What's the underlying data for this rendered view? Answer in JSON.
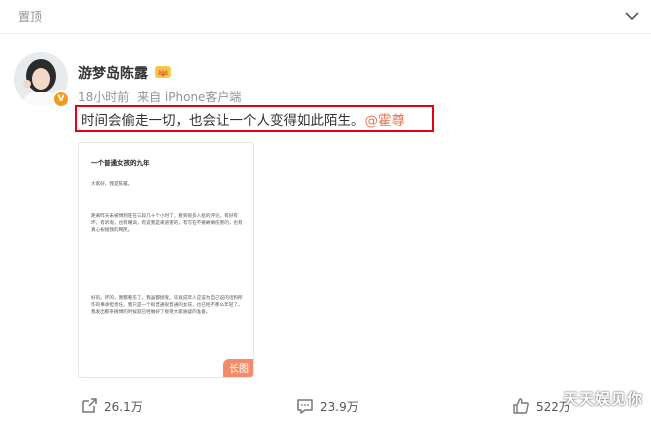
{
  "header": {
    "pin_label": "置顶",
    "chevron_icon": "chevron-down-icon"
  },
  "post": {
    "username": "游梦岛陈露",
    "verified_badge": "V",
    "time": "18小时前",
    "source": "来自 iPhone客户端",
    "text": "时间会偷走一切，也会让一个人变得如此陌生。",
    "mention": "@霍尊",
    "highlight_color": "#e60012"
  },
  "long_image": {
    "title": "一个普通女孩的九年",
    "greeting": "大家好，我是陈露。",
    "para1": "距离昨天未被博到旺在三段几十个小时了，看到很多人给的评论，有好有坏，有听瑕，也有嘲讽，有说我是来道害的，有写在不要故嘛伤害的，也有真心祝福我的网民。",
    "para2": "好的。坏的，我都看见了，我虽都接受。毕竟成年人应该为自己说的话和所作的事承担责任，我只是一个很普通很普通的女孩，也已经不那么年轻了。我发出那条微博的时候就已经做好了接受大家质疑的准备。",
    "badge": "长图"
  },
  "actions": {
    "repost_count": "26.1万",
    "comment_count": "23.9万",
    "like_count": "522万"
  },
  "watermark": "天天娱见你"
}
